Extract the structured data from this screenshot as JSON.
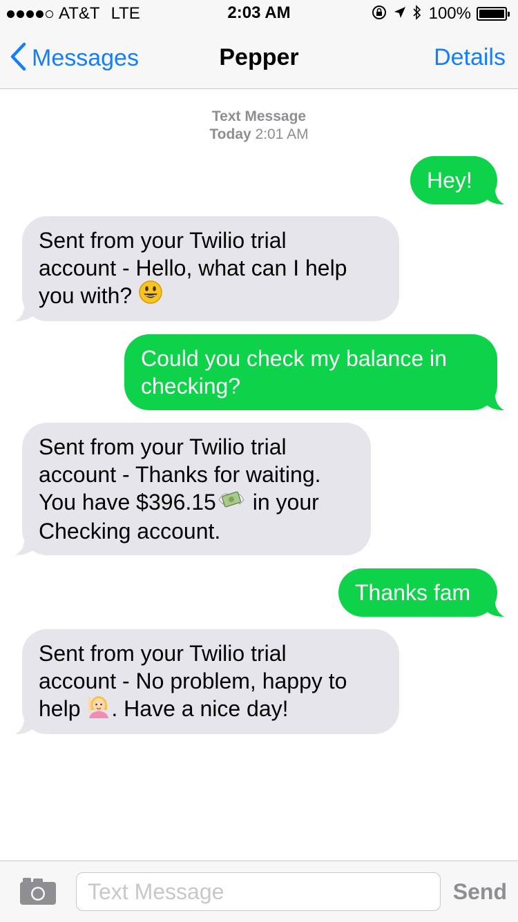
{
  "status_bar": {
    "carrier": "AT&T",
    "network": "LTE",
    "time": "2:03 AM",
    "battery": "100%",
    "signal_bars": 4,
    "signal_total": 5,
    "icons": [
      "rotation-lock-icon",
      "location-arrow-icon",
      "bluetooth-icon",
      "battery-icon"
    ]
  },
  "nav": {
    "back_label": "Messages",
    "title": "Pepper",
    "details_label": "Details"
  },
  "timestamp": {
    "label": "Text Message",
    "day": "Today",
    "time": "2:01 AM"
  },
  "messages": [
    {
      "from": "me",
      "lines": [
        "Hey!"
      ]
    },
    {
      "from": "them",
      "lines": [
        "Sent from your Twilio trial",
        "account - Hello, what can I help",
        "you with?"
      ],
      "emoji": "smiley-emoji"
    },
    {
      "from": "me",
      "lines": [
        "Could you check my balance in",
        "checking?"
      ]
    },
    {
      "from": "them",
      "lines": [
        "Sent from your Twilio trial",
        "account - Thanks for waiting.",
        "You have $396.15",
        "in your",
        "Checking account."
      ],
      "emoji": "money-with-wings-emoji"
    },
    {
      "from": "me",
      "lines": [
        "Thanks fam"
      ]
    },
    {
      "from": "them",
      "lines": [
        "Sent from your Twilio trial",
        "account - No problem, happy to",
        "help",
        ". Have a nice day!"
      ],
      "emoji": "woman-raising-hand-emoji"
    }
  ],
  "input": {
    "placeholder": "Text Message",
    "send_label": "Send"
  },
  "colors": {
    "accent": "#157efb",
    "sent_bubble": "#0dd24a",
    "received_bubble": "#e6e5eb",
    "meta_gray": "#8e8e93"
  }
}
